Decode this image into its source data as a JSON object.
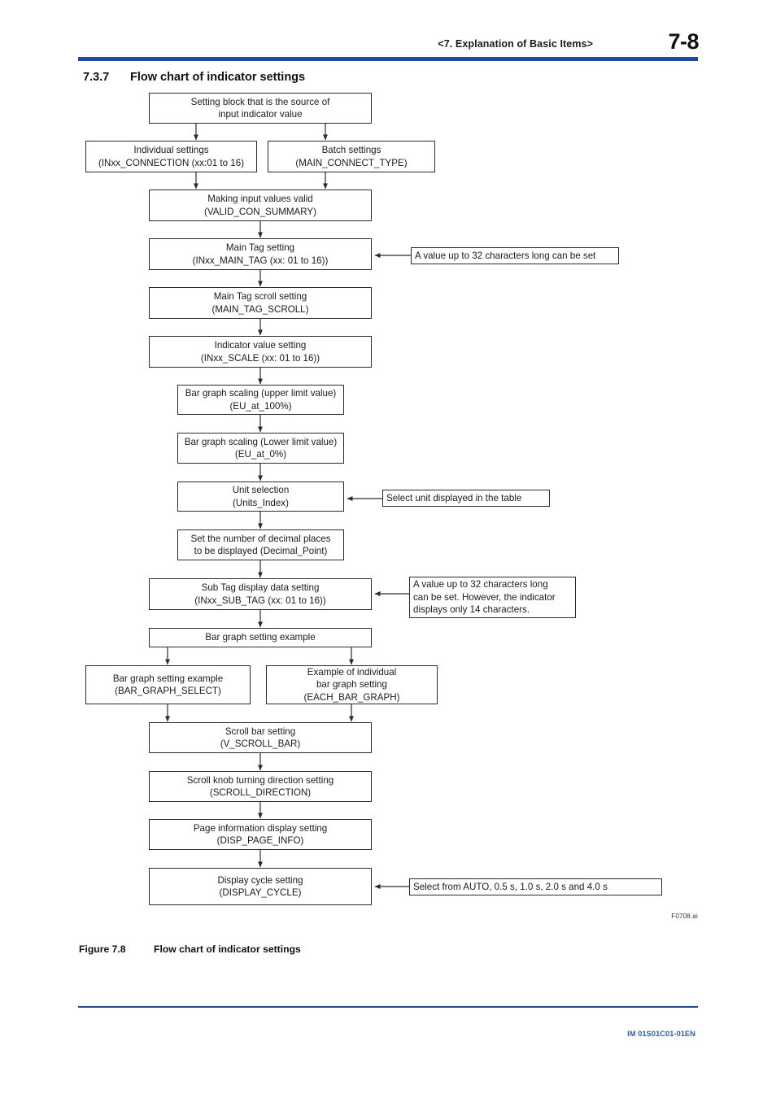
{
  "header": {
    "title": "<7.  Explanation of Basic Items>",
    "page_number": "7-8",
    "rule_color": "#24499a"
  },
  "section": {
    "number": "7.3.7",
    "title": "Flow chart of indicator settings"
  },
  "figure": {
    "code": "F0708.ai",
    "caption_number": "Figure 7.8",
    "caption_title": "Flow chart of indicator settings"
  },
  "footer": {
    "document_id": "IM 01S01C01-01EN",
    "document_id_color": "#2a5caa"
  },
  "flowchart": {
    "nodes": [
      {
        "id": "source-block",
        "line1": "Setting block that is the source of",
        "line2": "input indicator value"
      },
      {
        "id": "individual-settings",
        "line1": "Individual settings",
        "line2": "(INxx_CONNECTION (xx:01 to 16)"
      },
      {
        "id": "batch-settings",
        "line1": "Batch settings",
        "line2": "(MAIN_CONNECT_TYPE)"
      },
      {
        "id": "valid-con-summary",
        "line1": "Making input values valid",
        "line2": "(VALID_CON_SUMMARY)"
      },
      {
        "id": "main-tag-setting",
        "line1": "Main Tag setting",
        "line2": "(INxx_MAIN_TAG (xx: 01 to 16))"
      },
      {
        "id": "main-tag-scroll",
        "line1": "Main Tag scroll setting",
        "line2": "(MAIN_TAG_SCROLL)"
      },
      {
        "id": "indicator-value-setting",
        "line1": "Indicator value setting",
        "line2": "(INxx_SCALE (xx: 01 to 16))"
      },
      {
        "id": "bar-graph-upper",
        "line1": "Bar graph scaling (upper limit value)",
        "line2": "(EU_at_100%)"
      },
      {
        "id": "bar-graph-lower",
        "line1": "Bar graph scaling (Lower limit value)",
        "line2": "(EU_at_0%)"
      },
      {
        "id": "unit-selection",
        "line1": "Unit selection",
        "line2": "(Units_Index)"
      },
      {
        "id": "decimal-point",
        "line1": "Set the number of decimal places",
        "line2": "to be displayed (Decimal_Point)"
      },
      {
        "id": "sub-tag-setting",
        "line1": "Sub Tag display data setting",
        "line2": "(INxx_SUB_TAG (xx: 01 to 16))"
      },
      {
        "id": "bar-graph-example",
        "line1": "Bar graph setting example",
        "line2": ""
      },
      {
        "id": "bar-graph-select",
        "line1": "Bar graph setting example",
        "line2": "(BAR_GRAPH_SELECT)"
      },
      {
        "id": "each-bar-graph",
        "line1": "Example of individual",
        "line2": "bar graph setting",
        "line3": "(EACH_BAR_GRAPH)"
      },
      {
        "id": "scroll-bar-setting",
        "line1": "Scroll bar setting",
        "line2": "(V_SCROLL_BAR)"
      },
      {
        "id": "scroll-direction",
        "line1": "Scroll knob turning direction setting",
        "line2": "(SCROLL_DIRECTION)"
      },
      {
        "id": "disp-page-info",
        "line1": "Page information display setting",
        "line2": "(DISP_PAGE_INFO)"
      },
      {
        "id": "display-cycle",
        "line1": "Display cycle setting",
        "line2": "(DISPLAY_CYCLE)"
      }
    ],
    "notes": [
      {
        "id": "note-main-tag",
        "line1": "A value up to 32 characters long can be set"
      },
      {
        "id": "note-unit",
        "line1": "Select unit displayed in the table"
      },
      {
        "id": "note-sub-tag",
        "line1": "A value up to 32 characters long",
        "line2": "can be set. However, the indicator",
        "line3": "displays only 14 characters."
      },
      {
        "id": "note-display-cycle",
        "line1": "Select from AUTO, 0.5 s, 1.0 s, 2.0 s and 4.0 s"
      }
    ]
  }
}
